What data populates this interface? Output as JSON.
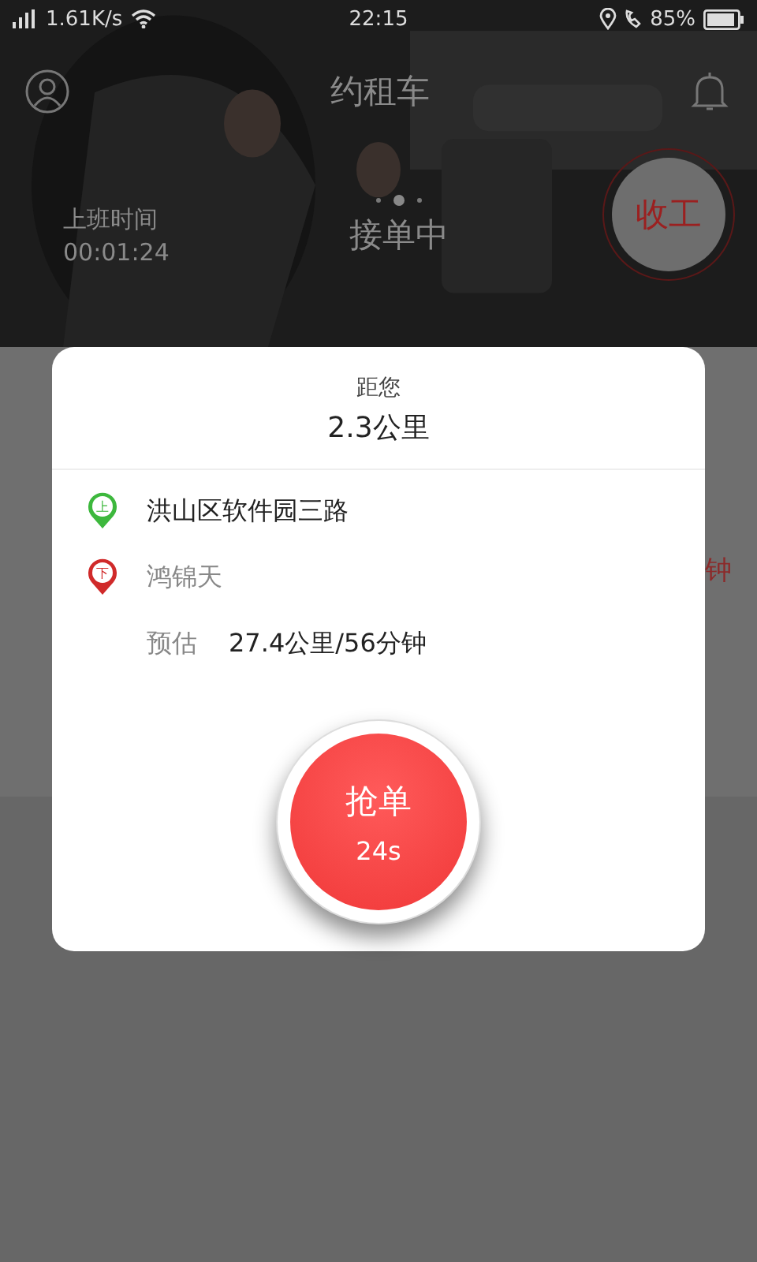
{
  "status_bar": {
    "speed": "1.61K/s",
    "time": "22:15",
    "battery": "85%"
  },
  "header": {
    "title": "约租车",
    "work_time_label": "上班时间",
    "work_time": "00:01:24",
    "status": "接单中",
    "finish_button": "收工"
  },
  "background_list": {
    "trailing_text": "钟"
  },
  "order_dialog": {
    "distance_label": "距您",
    "distance": "2.3公里",
    "stops": [
      {
        "kind": "pickup",
        "pin_label": "上",
        "address": "洪山区软件园三路"
      },
      {
        "kind": "dropoff",
        "pin_label": "下",
        "address": "鸿锦天"
      }
    ],
    "estimate_label": "预估",
    "estimate": "27.4公里/56分钟",
    "grab_button": {
      "label": "抢单",
      "countdown": "24s"
    }
  }
}
